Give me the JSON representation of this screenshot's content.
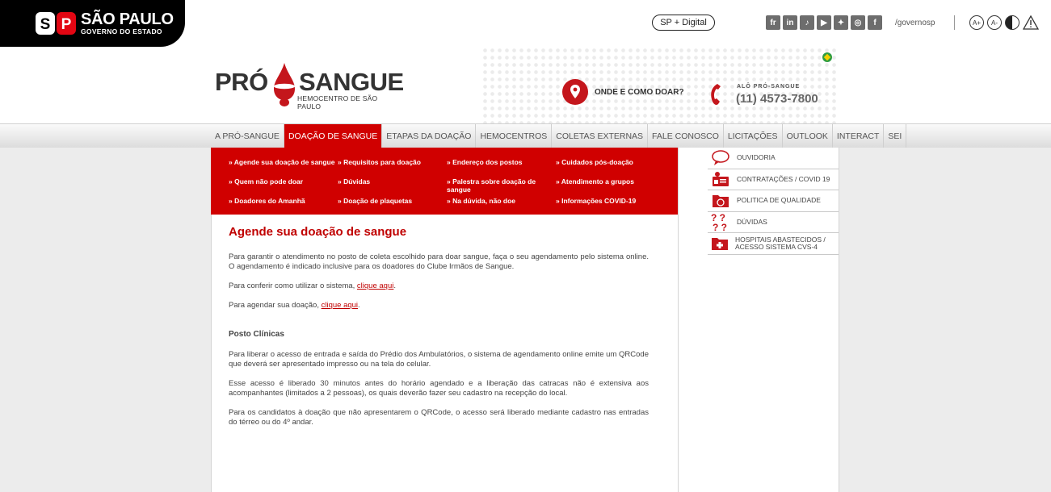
{
  "gov": {
    "title": "SÃO PAULO",
    "subtitle": "GOVERNO DO ESTADO",
    "sp_digital": "SP + Digital",
    "social": [
      {
        "icon": "flickr-icon",
        "glyph": "fr"
      },
      {
        "icon": "linkedin-icon",
        "glyph": "in"
      },
      {
        "icon": "tiktok-icon",
        "glyph": "♪"
      },
      {
        "icon": "youtube-icon",
        "glyph": "▶"
      },
      {
        "icon": "twitter-icon",
        "glyph": "✦"
      },
      {
        "icon": "instagram-icon",
        "glyph": "◎"
      },
      {
        "icon": "facebook-icon",
        "glyph": "f"
      }
    ],
    "social_handle": "/governosp",
    "a11y": {
      "increase": "A+",
      "decrease": "A-"
    }
  },
  "header": {
    "logo_left": "PRÓ",
    "logo_right": "SANGUE",
    "logo_sub": "HEMOCENTRO DE SÃO PAULO",
    "onde": "ONDE E COMO DOAR?",
    "alo": "ALÔ PRÓ-SANGUE",
    "phone": "(11) 4573-7800"
  },
  "nav": [
    "A PRÓ-SANGUE",
    "DOAÇÃO DE SANGUE",
    "ETAPAS DA DOAÇÃO",
    "HEMOCENTROS",
    "COLETAS EXTERNAS",
    "FALE CONOSCO",
    "LICITAÇÕES",
    "OUTLOOK",
    "INTERACT",
    "SEI"
  ],
  "nav_active": 1,
  "submenu": [
    [
      "» Agende sua doação de sangue",
      "» Quem não pode doar",
      "» Doadores do Amanhã"
    ],
    [
      "» Requisitos para doação",
      "» Dúvidas",
      "» Doação de plaquetas"
    ],
    [
      "» Endereço dos postos",
      "» Palestra sobre doação de sangue",
      "» Na dúvida, não doe"
    ],
    [
      "» Cuidados pós-doação",
      "» Atendimento a grupos",
      "» Informações COVID-19"
    ]
  ],
  "main": {
    "title": "Agende sua doação de sangue",
    "p1": "Para garantir o atendimento no posto de coleta escolhido para doar sangue, faça o seu agendamento pelo sistema online. O agendamento é indicado inclusive para os doadores do Clube Irmãos de Sangue.",
    "p2_pre": "Para conferir como utilizar o sistema, ",
    "p3_pre": "Para agendar sua doação, ",
    "link": "clique aqui",
    "punct": ".",
    "section": "Posto Clínicas",
    "p4": "Para liberar o acesso de entrada e saída do Prédio dos Ambulatórios, o sistema de agendamento online emite um QRCode que deverá ser apresentado impresso ou na tela do celular.",
    "p5": "Esse acesso é liberado 30 minutos antes do horário agendado e a liberação das catracas não é extensiva aos acompanhantes (limitados a 2 pessoas), os quais deverão fazer seu cadastro na recepção do local.",
    "p6": "Para os candidatos à doação que não apresentarem o QRCode, o acesso será liberado mediante cadastro nas entradas do térreo ou do 4º andar."
  },
  "right_menu": [
    {
      "label": "OUVIDORIA",
      "icon": "speech-bubble-icon"
    },
    {
      "label": "CONTRATAÇÕES / COVID 19",
      "icon": "id-card-icon"
    },
    {
      "label": "POLITICA DE QUALIDADE",
      "icon": "folder-icon"
    },
    {
      "label": "DÚVIDAS",
      "icon": "question-marks-icon"
    },
    {
      "label": "HOSPITAIS ABASTECIDOS / ACESSO SISTEMA CVS-4",
      "icon": "hospital-folder-icon"
    }
  ],
  "colors": {
    "brand_red": "#d00000",
    "text_red": "#c00000"
  }
}
